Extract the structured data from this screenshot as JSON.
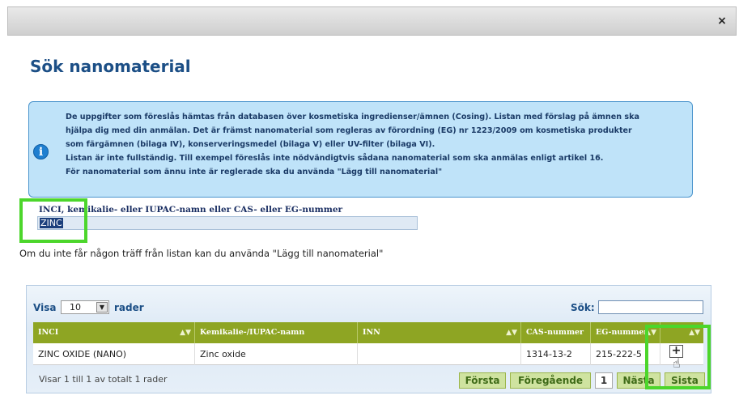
{
  "window": {
    "close_label": "×"
  },
  "page": {
    "title": "Sök nanomaterial"
  },
  "info": {
    "lines": [
      "De uppgifter som föreslås hämtas från databasen över kosmetiska ingredienser/ämnen (Cosing). Listan med förslag på ämnen ska",
      "hjälpa dig med din anmälan. Det är främst nanomaterial som regleras av förordning (EG) nr 1223/2009 om kosmetiska produkter",
      "som färgämnen (bilaga IV), konserveringsmedel (bilaga V) eller UV-filter (bilaga VI).",
      "Listan är inte fullständig. Till exempel föreslås inte nödvändigtvis sådana nanomaterial som ska anmälas enligt artikel 16.",
      "För nanomaterial som ännu inte är reglerade ska du använda \"Lägg till nanomaterial\""
    ],
    "icon": "i"
  },
  "search": {
    "label": "INCI, kemikalie- eller IUPAC-namn eller CAS- eller EG-nummer",
    "value": "ZINC"
  },
  "hint": "Om du inte får någon träff från listan kan du använda \"Lägg till nanomaterial\"",
  "table": {
    "visa_label": "Visa",
    "page_size": "10",
    "rows_label": "rader",
    "search_label": "Sök:",
    "columns": [
      "INCI",
      "Kemikalie-/IUPAC-namn",
      "INN",
      "CAS-nummer",
      "EG-nummer",
      ""
    ],
    "rows": [
      {
        "inci": "ZINC OXIDE (NANO)",
        "chem": "Zinc oxide",
        "inn": "",
        "cas": "1314-13-2",
        "eg": "215-222-5"
      }
    ],
    "add_label": "+",
    "status": "Visar 1 till 1 av totalt 1 rader",
    "pager": {
      "first": "Första",
      "prev": "Föregående",
      "current": "1",
      "next": "Nästa",
      "last": "Sista"
    }
  }
}
